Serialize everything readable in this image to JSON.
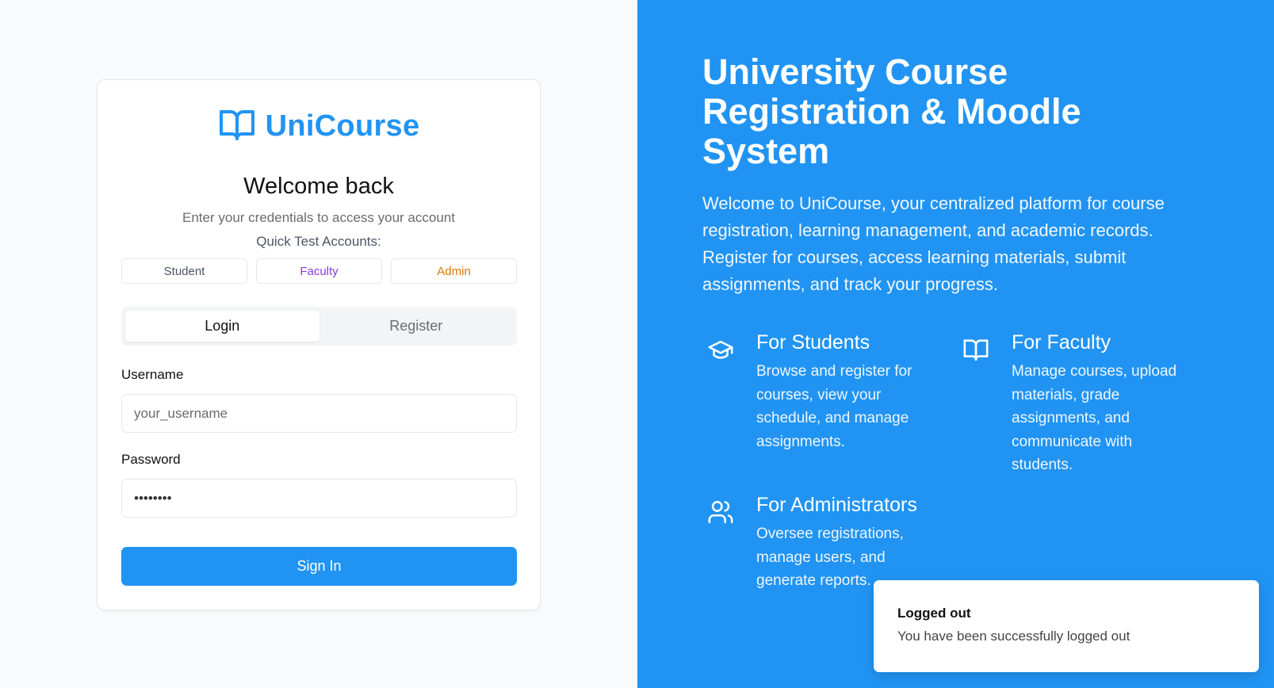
{
  "brand": {
    "name": "UniCourse",
    "icon": "book-open-icon",
    "color": "#2194f3"
  },
  "login": {
    "heading": "Welcome back",
    "subheading": "Enter your credentials to access your account",
    "quick_title": "Quick Test Accounts:",
    "quick_accounts": [
      {
        "label": "Student",
        "color": "#4b5563"
      },
      {
        "label": "Faculty",
        "color": "#8b3bd9"
      },
      {
        "label": "Admin",
        "color": "#d97706"
      }
    ],
    "tabs": [
      {
        "label": "Login",
        "active": true
      },
      {
        "label": "Register",
        "active": false
      }
    ],
    "username_label": "Username",
    "username_placeholder": "your_username",
    "password_label": "Password",
    "password_value": "••••••••",
    "submit_label": "Sign In"
  },
  "hero": {
    "title": "University Course Registration & Moodle System",
    "description": "Welcome to UniCourse, your centralized platform for course registration, learning management, and academic records. Register for courses, access learning materials, submit assignments, and track your progress.",
    "features": [
      {
        "icon": "graduation-cap-icon",
        "title": "For Students",
        "description": "Browse and register for courses, view your schedule, and manage assignments."
      },
      {
        "icon": "book-open-icon",
        "title": "For Faculty",
        "description": "Manage courses, upload materials, grade assignments, and communicate with students."
      },
      {
        "icon": "users-icon",
        "title": "For Administrators",
        "description": "Oversee registrations, manage users, and generate reports."
      }
    ]
  },
  "toast": {
    "title": "Logged out",
    "message": "You have been successfully logged out"
  },
  "colors": {
    "accent": "#2194f3",
    "background": "#f8fafc"
  }
}
